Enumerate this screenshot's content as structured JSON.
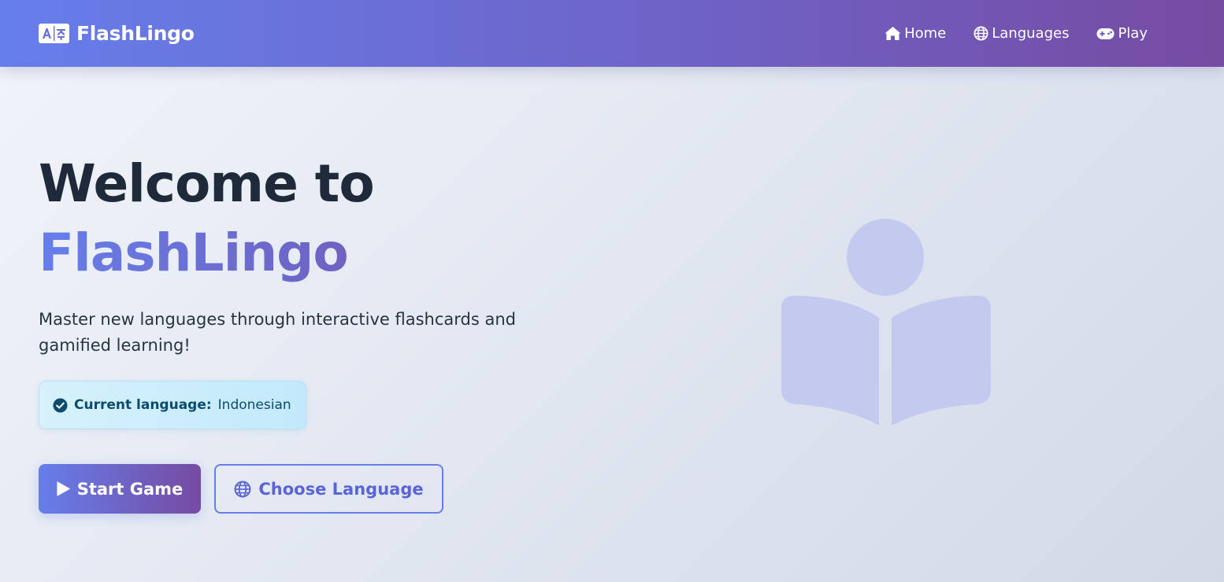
{
  "navbar": {
    "brand": "FlashLingo",
    "brand_icon": "language-icon",
    "links": [
      {
        "label": "Home",
        "icon": "home-icon"
      },
      {
        "label": "Languages",
        "icon": "globe-icon"
      },
      {
        "label": "Play",
        "icon": "gamepad-icon"
      }
    ]
  },
  "hero": {
    "title_line1": "Welcome to",
    "title_line2": "FlashLingo",
    "subtitle": "Master new languages through interactive flashcards and gamified learning!",
    "current_language_label": "Current language:",
    "current_language_value": "Indonesian",
    "start_button": "Start Game",
    "choose_button": "Choose Language",
    "illustration_icon": "book-reader-icon"
  },
  "colors": {
    "brand_gradient_start": "#667eea",
    "brand_gradient_end": "#764ba2",
    "alert_background": "#c9ecfa",
    "alert_text": "#0b4b6e",
    "heading_text": "#1e2939",
    "illustration": "#c4c9ef"
  }
}
